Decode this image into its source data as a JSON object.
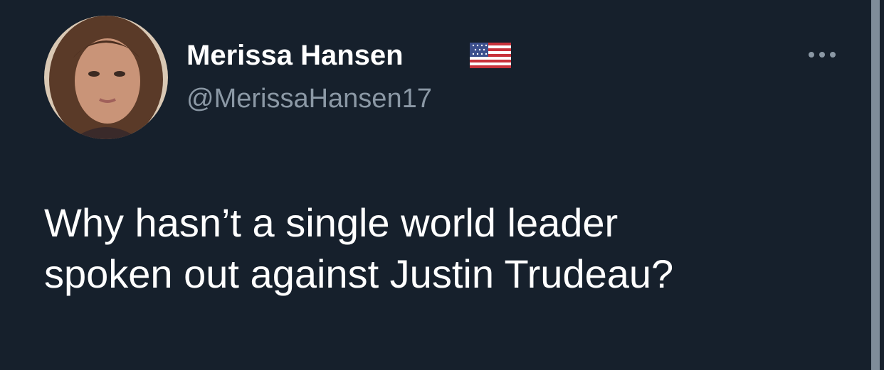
{
  "tweet": {
    "author": {
      "display_name": "Merissa Hansen",
      "badge_icon": "us-flag-icon",
      "handle": "@MerissaHansen17",
      "avatar_icon": "avatar-photo"
    },
    "menu_icon": "more-options-icon",
    "text_line1": "Why hasn’t a single world leader",
    "text_line2": "spoken out against Justin Trudeau?"
  },
  "colors": {
    "background": "#16202c",
    "primary_text": "#ffffff",
    "secondary_text": "#8b98a5"
  }
}
